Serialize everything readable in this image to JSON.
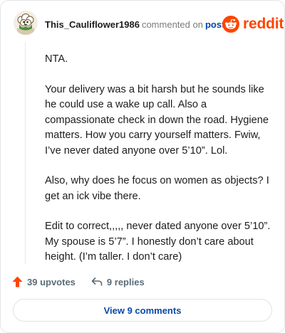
{
  "comment": {
    "username": "This_Cauliflower1986",
    "action_text": "commented on",
    "post_link": "post",
    "avatar_icon": "cauliflower-avatar-icon",
    "paragraphs": [
      "NTA.",
      "Your delivery was a bit harsh but he sounds like he could use a wake up call. Also a compassionate check in down the road. Hygiene matters. How you carry yourself matters. Fwiw, I’ve never dated anyone over 5’10”. Lol.",
      "Also, why does he focus on women as objects? I get an ick vibe there.",
      "Edit to correct,,,,, never dated anyone over 5’10”. My spouse is 5’7”. I honestly don’t care about height. (I’m taller. I don’t care)"
    ]
  },
  "brand": {
    "wordmark": "reddit",
    "icon": "reddit-snoo-icon",
    "color": "#ff4500"
  },
  "stats": {
    "upvotes": "39 upvotes",
    "replies": "9 replies",
    "upvote_color": "#ff4500"
  },
  "footer": {
    "view_comments": "View 9 comments"
  }
}
